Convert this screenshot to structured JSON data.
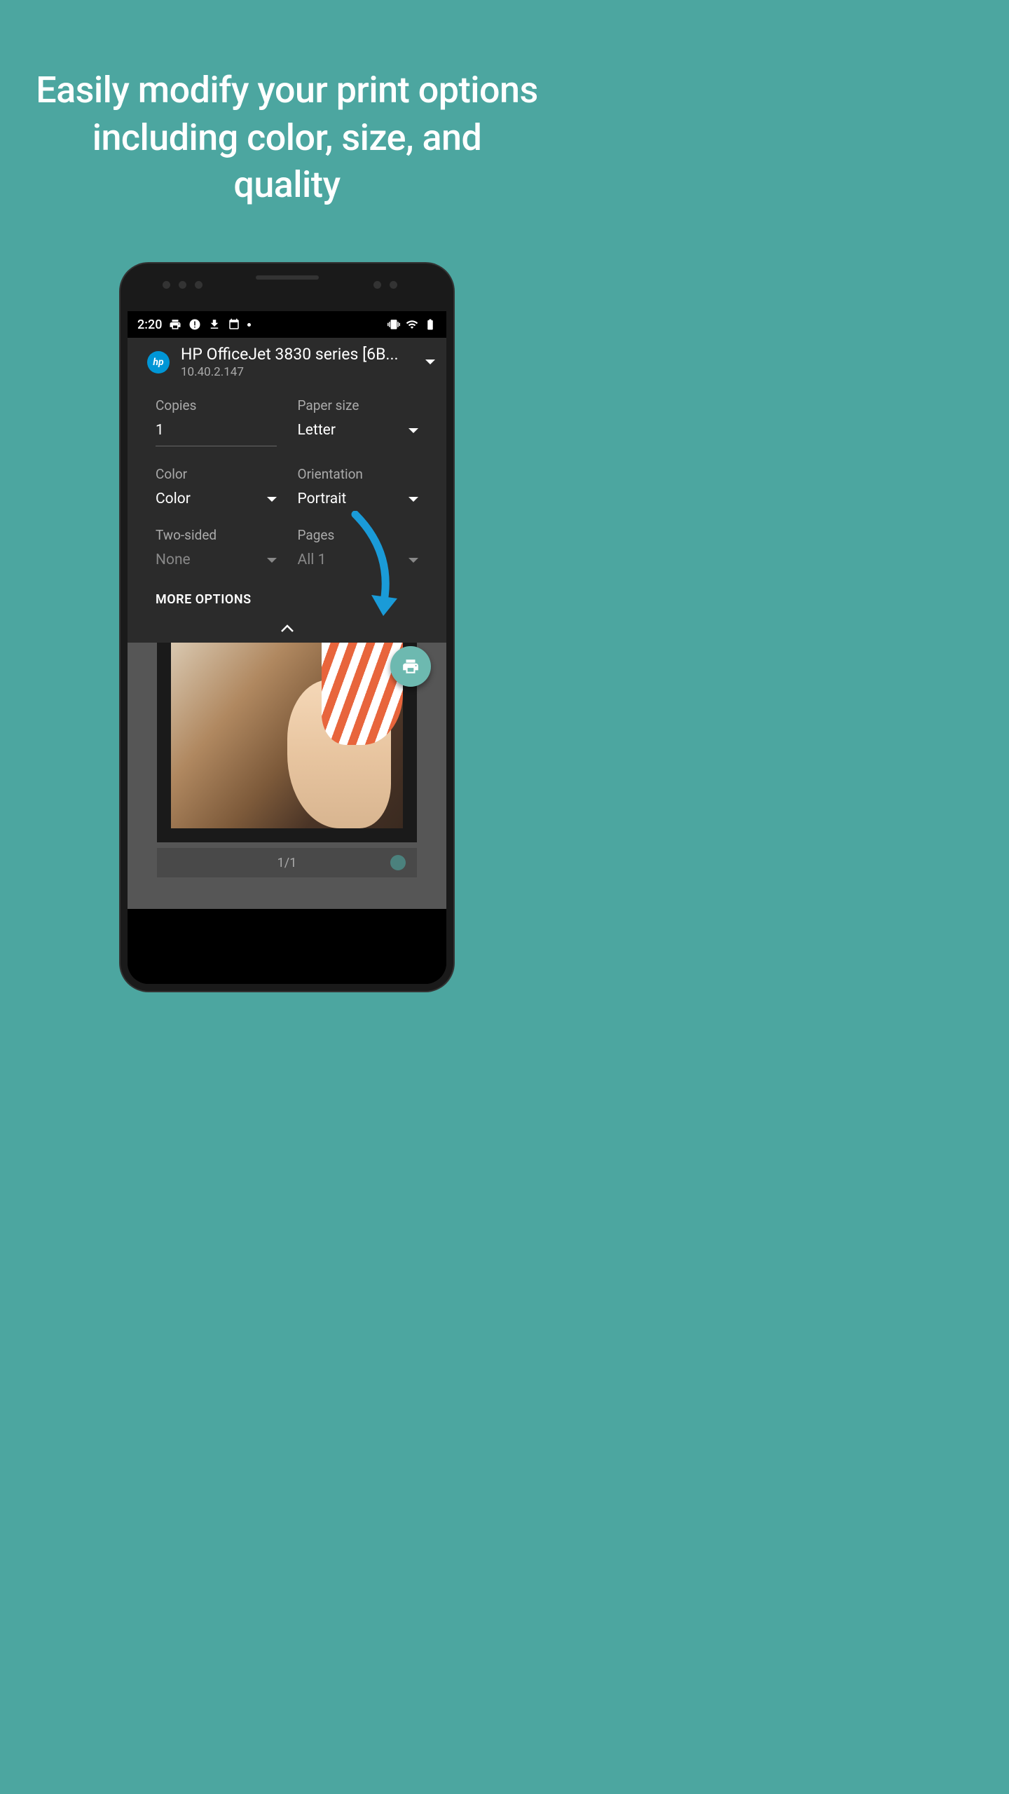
{
  "headline": "Easily modify your print options including color, size, and quality",
  "status": {
    "time": "2:20"
  },
  "printer": {
    "name": "HP OfficeJet 3830 series [6B...",
    "ip": "10.40.2.147"
  },
  "options": {
    "copies_label": "Copies",
    "copies_value": "1",
    "paper_label": "Paper size",
    "paper_value": "Letter",
    "color_label": "Color",
    "color_value": "Color",
    "orient_label": "Orientation",
    "orient_value": "Portrait",
    "twosided_label": "Two-sided",
    "twosided_value": "None",
    "pages_label": "Pages",
    "pages_value": "All 1"
  },
  "more_options": "MORE OPTIONS",
  "page_counter": "1/1"
}
